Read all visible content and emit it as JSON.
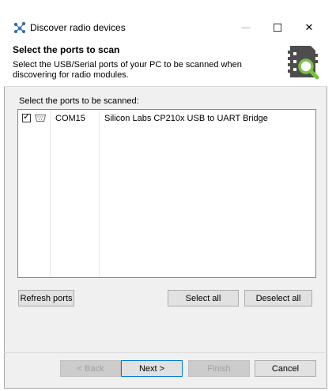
{
  "window": {
    "title": "Discover radio devices",
    "minimize_glyph": "—",
    "maximize_glyph": "☐",
    "close_glyph": "✕"
  },
  "header": {
    "title": "Select the ports to scan",
    "description": "Select the USB/Serial ports of your PC to be scanned when discovering for radio modules.",
    "icon": "radio-module-search-icon"
  },
  "ports": {
    "label": "Select the ports to be scanned:",
    "items": [
      {
        "checked": true,
        "check_glyph": "✓",
        "icon": "serial-port-icon",
        "port": "COM15",
        "description": "Silicon Labs CP210x USB to UART Bridge"
      }
    ]
  },
  "buttons": {
    "refresh": "Refresh ports",
    "select_all": "Select all",
    "deselect_all": "Deselect all",
    "back": "< Back",
    "next": "Next >",
    "finish": "Finish",
    "cancel": "Cancel"
  },
  "colors": {
    "accent": "#0078d7",
    "header_icon_bg": "#4d4d4d",
    "search_green": "#7ac143"
  }
}
